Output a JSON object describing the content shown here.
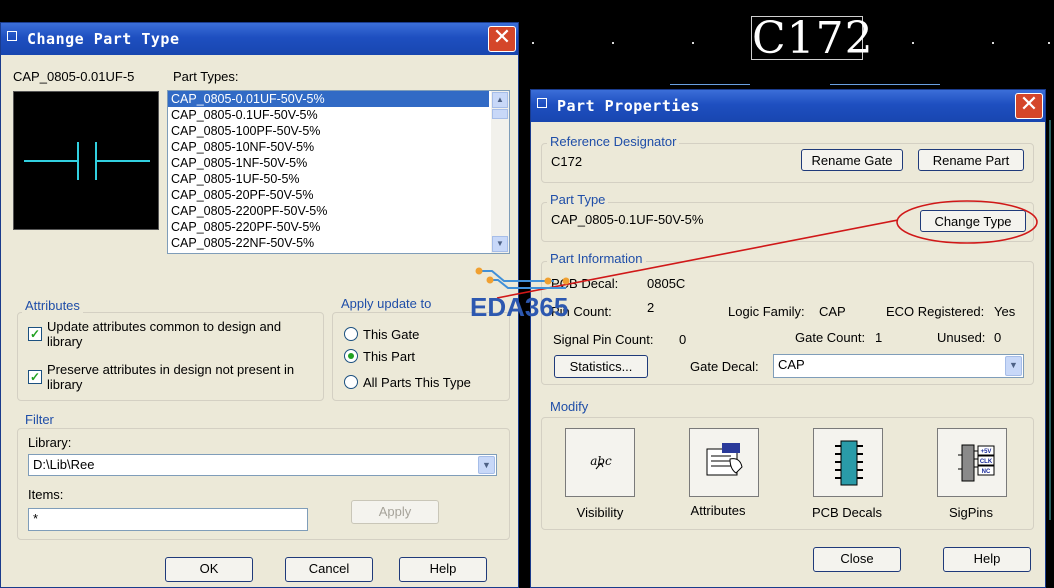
{
  "pcb": {
    "ref_label": "C172"
  },
  "change_dialog": {
    "title": "Change Part Type",
    "current_part": "CAP_0805-0.01UF-5",
    "part_types_label": "Part Types:",
    "part_types": [
      "CAP_0805-0.01UF-50V-5%",
      "CAP_0805-0.1UF-50V-5%",
      "CAP_0805-100PF-50V-5%",
      "CAP_0805-10NF-50V-5%",
      "CAP_0805-1NF-50V-5%",
      "CAP_0805-1UF-50-5%",
      "CAP_0805-20PF-50V-5%",
      "CAP_0805-2200PF-50V-5%",
      "CAP_0805-220PF-50V-5%",
      "CAP_0805-22NF-50V-5%"
    ],
    "selected_index": 0,
    "attributes": {
      "title": "Attributes",
      "update_common": "Update attributes common to design and library",
      "update_common_checked": true,
      "preserve": "Preserve attributes in design not present in library",
      "preserve_checked": true
    },
    "apply_update": {
      "title": "Apply update to",
      "options": [
        "This Gate",
        "This Part",
        "All Parts This Type"
      ],
      "selected": "This Part"
    },
    "filter": {
      "title": "Filter",
      "library_label": "Library:",
      "library_value": "D:\\Lib\\Ree",
      "items_label": "Items:",
      "items_value": "*",
      "apply_label": "Apply"
    },
    "ok_label": "OK",
    "cancel_label": "Cancel",
    "help_label": "Help"
  },
  "props_dialog": {
    "title": "Part Properties",
    "ref_designator": {
      "title": "Reference Designator",
      "value": "C172",
      "rename_gate": "Rename Gate",
      "rename_part": "Rename Part"
    },
    "part_type": {
      "title": "Part Type",
      "value": "CAP_0805-0.1UF-50V-5%",
      "change_type": "Change Type"
    },
    "part_info": {
      "title": "Part Information",
      "pcb_decal_label": "PCB Decal:",
      "pcb_decal_value": "0805C",
      "pin_count_label": "Pin Count:",
      "pin_count_value": "2",
      "logic_family_label": "Logic Family:",
      "logic_family_value": "CAP",
      "eco_label": "ECO Registered:",
      "eco_value": "Yes",
      "signal_pin_label": "Signal Pin Count:",
      "signal_pin_value": "0",
      "gate_count_label": "Gate Count:",
      "gate_count_value": "1",
      "unused_label": "Unused:",
      "unused_value": "0",
      "statistics_label": "Statistics...",
      "gate_decal_label": "Gate Decal:",
      "gate_decal_value": "CAP"
    },
    "modify": {
      "title": "Modify",
      "visibility": "Visibility",
      "attributes": "Attributes",
      "pcb_decals": "PCB Decals",
      "sigpins": "SigPins",
      "visibility_icon_text": "abc",
      "sigpins_icon_texts": [
        "+5V",
        "CLK",
        "NC"
      ]
    },
    "close_label": "Close",
    "help_label": "Help"
  },
  "watermark": "EDA365",
  "colors": {
    "title_bar": "#1e4fc0",
    "dialog_bg": "#ece9d8",
    "annotation": "#d01818",
    "group_title": "#1f4ea8"
  }
}
